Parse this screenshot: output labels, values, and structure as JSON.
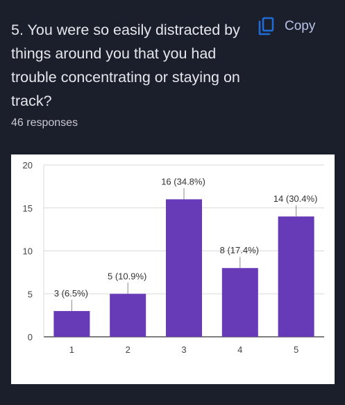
{
  "question": {
    "text": "5. You were so easily distracted by things around you that you had trouble concentrating or staying on track?"
  },
  "copy": {
    "label": "Copy",
    "icon": "copy-icon",
    "color": "#b9c4e8"
  },
  "responses": {
    "text": "46 responses"
  },
  "colors": {
    "background": "#1b1e2b",
    "bar": "#673ab7",
    "card": "#ffffff"
  },
  "chart_data": {
    "type": "bar",
    "categories": [
      "1",
      "2",
      "3",
      "4",
      "5"
    ],
    "values": [
      3,
      5,
      16,
      8,
      14
    ],
    "data_labels": [
      "3 (6.5%)",
      "5 (10.9%)",
      "16 (34.8%)",
      "8 (17.4%)",
      "14 (30.4%)"
    ],
    "ylim": [
      0,
      20
    ],
    "yticks": [
      "0",
      "5",
      "10",
      "15",
      "20"
    ],
    "grid": true,
    "title": "",
    "xlabel": "",
    "ylabel": ""
  }
}
